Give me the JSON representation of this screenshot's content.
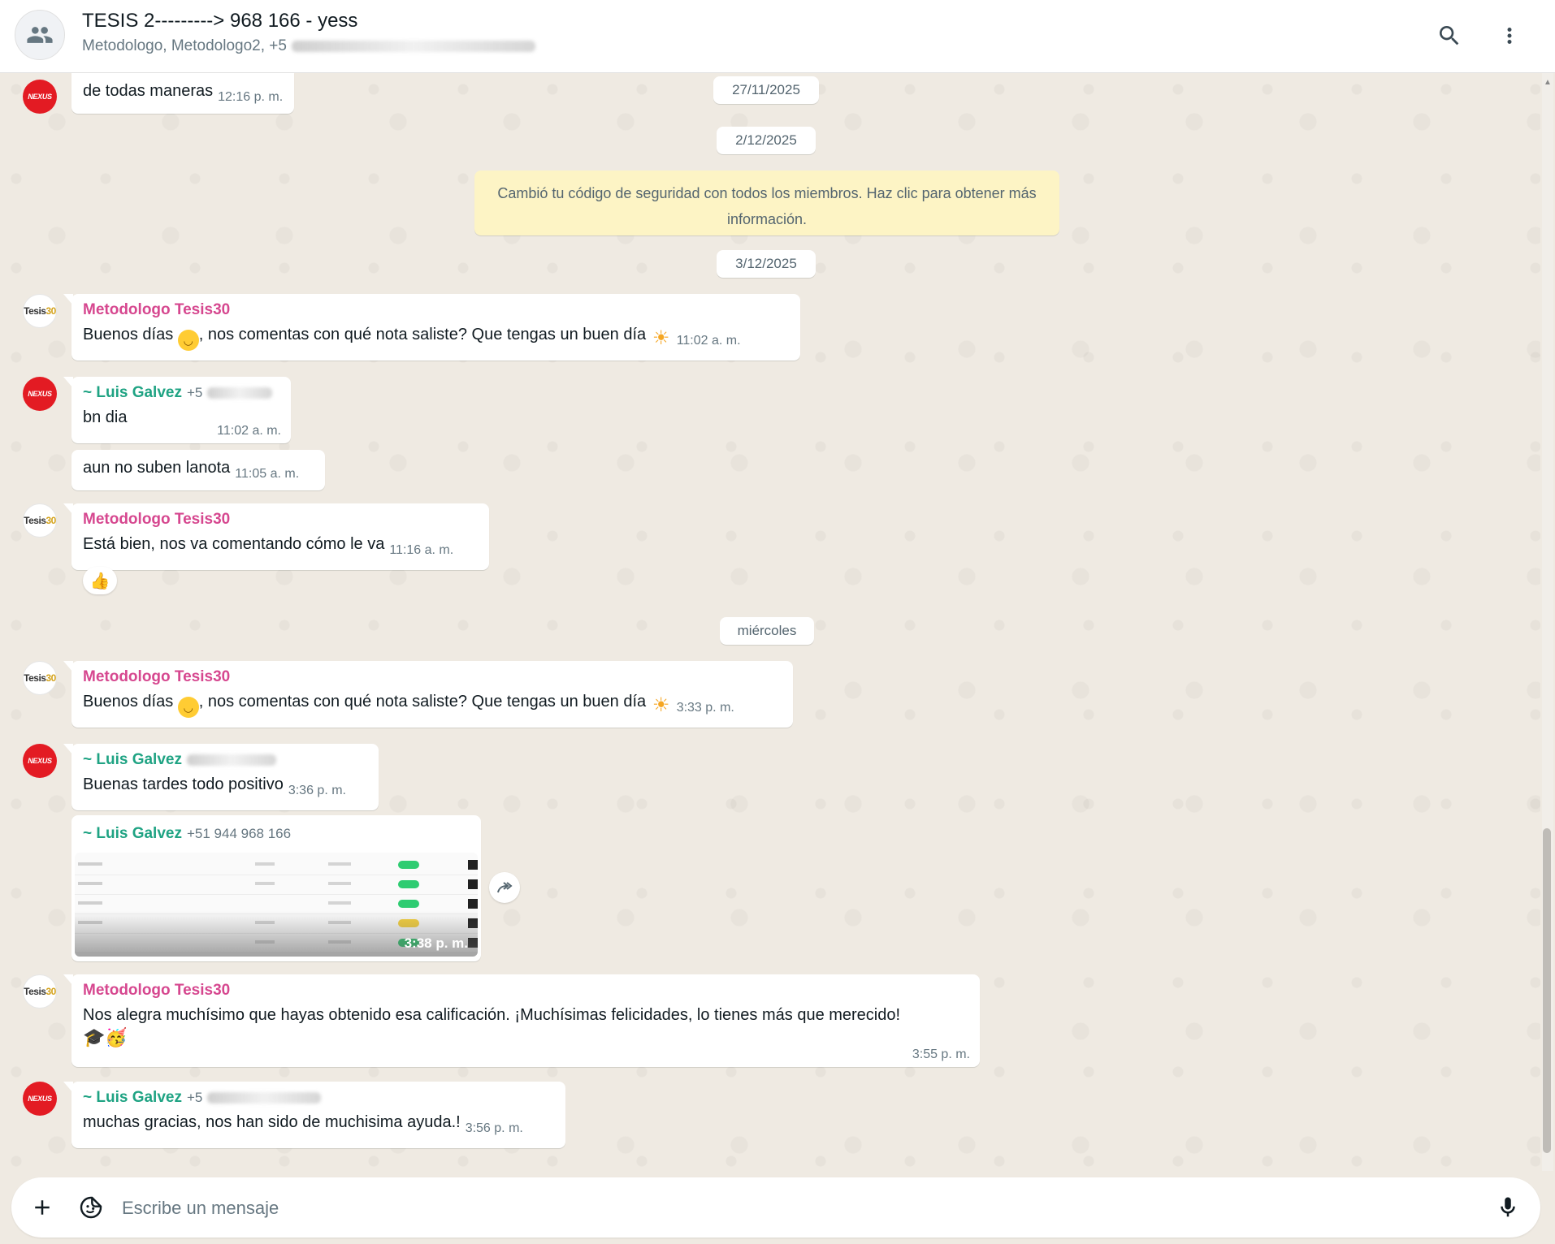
{
  "header": {
    "title": "TESIS 2---------> 968 166 - yess",
    "subtitle": "Metodologo, Metodologo2, +5",
    "icons": [
      "group-icon",
      "search-icon",
      "more-vert-icon"
    ]
  },
  "dates": [
    "27/11/2025",
    "2/12/2025",
    "3/12/2025",
    "miércoles"
  ],
  "system_message": "Cambió tu código de seguridad con todos los miembros. Haz clic para obtener más información.",
  "messages": [
    {
      "sender": "",
      "text": "de todas maneras",
      "time": "12:16 p. m."
    },
    {
      "sender": "Metodologo Tesis30",
      "text_a": "Buenos días ",
      "text_b": ", nos comentas con qué nota saliste? Que tengas un buen día ",
      "time": "11:02 a. m."
    },
    {
      "sender": "~ Luis Galvez",
      "phone": "+5",
      "text": "bn dia",
      "time": "11:02 a. m."
    },
    {
      "sender": "",
      "text": "aun no suben lanota",
      "time": "11:05 a. m."
    },
    {
      "sender": "Metodologo Tesis30",
      "text": "Está bien, nos va comentando cómo le va",
      "time": "11:16 a. m.",
      "reaction": "👍"
    },
    {
      "sender": "Metodologo Tesis30",
      "text_a": "Buenos días ",
      "text_b": ", nos comentas con qué nota saliste? Que tengas un buen día ",
      "time": "3:33 p. m."
    },
    {
      "sender": "~ Luis Galvez",
      "text": "Buenas tardes todo positivo",
      "time": "3:36 p. m."
    },
    {
      "sender": "~ Luis Galvez",
      "phone": "+51 944 968 166",
      "time": "3:38 p. m.",
      "media": "image"
    },
    {
      "sender": "Metodologo Tesis30",
      "text": "Nos alegra muchísimo que hayas obtenido esa calificación. ¡Muchísimas felicidades, lo tienes más que merecido!",
      "emojis": "🎓🥳",
      "time": "3:55 p. m."
    },
    {
      "sender": "~ Luis Galvez",
      "phone": "+5",
      "text": "muchas gracias, nos han sido de muchisima ayuda.!",
      "time": "3:56 p. m."
    }
  ],
  "avatars": {
    "nexus": "NEXUS",
    "tesis": "Tesis",
    "tesis_suffix": "30"
  },
  "composer": {
    "placeholder": "Escribe un mensaje"
  },
  "colors": {
    "background": "#efeae2",
    "bubble": "#ffffff",
    "system": "#fdf4c5",
    "pink_sender": "#d6478f",
    "teal_sender": "#1fa383",
    "time": "#667781"
  }
}
